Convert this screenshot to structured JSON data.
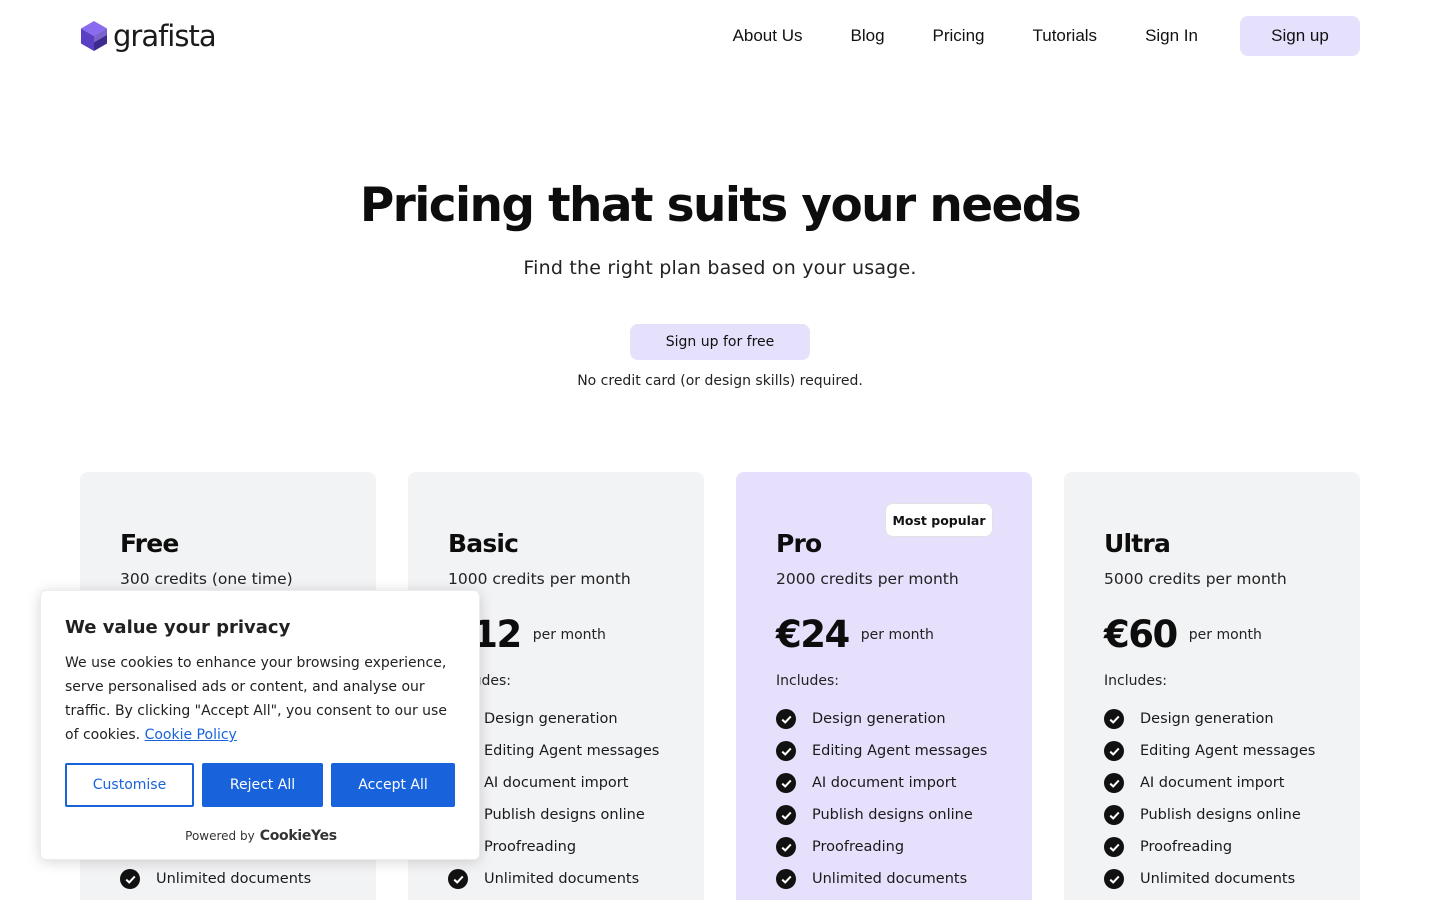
{
  "brand": {
    "name": "grafista",
    "logo_icon": "cube-logo-icon",
    "accent": "#6b4fd8"
  },
  "nav": {
    "links": [
      "About Us",
      "Blog",
      "Pricing",
      "Tutorials",
      "Sign In"
    ],
    "signup_label": "Sign up"
  },
  "hero": {
    "title": "Pricing that suits your needs",
    "subtitle": "Find the right plan based on your usage.",
    "cta_label": "Sign up for free",
    "note": "No credit card (or design skills) required."
  },
  "plans": [
    {
      "name": "Free",
      "credits": "300 credits (one time)",
      "price": "",
      "period": "",
      "includes_label": "",
      "features": [
        "",
        "",
        "",
        "",
        "",
        "Unlimited documents"
      ]
    },
    {
      "name": "Basic",
      "credits": "1000 credits per month",
      "price": "€12",
      "period": "per month",
      "includes_label": "Includes:",
      "features": [
        "Design generation",
        "Editing Agent messages",
        "AI document import",
        "Publish designs online",
        "Proofreading",
        "Unlimited documents"
      ]
    },
    {
      "name": "Pro",
      "credits": "2000 credits per month",
      "price": "€24",
      "period": "per month",
      "includes_label": "Includes:",
      "badge": "Most popular",
      "features": [
        "Design generation",
        "Editing Agent messages",
        "AI document import",
        "Publish designs online",
        "Proofreading",
        "Unlimited documents"
      ]
    },
    {
      "name": "Ultra",
      "credits": "5000 credits per month",
      "price": "€60",
      "period": "per month",
      "includes_label": "Includes:",
      "features": [
        "Design generation",
        "Editing Agent messages",
        "AI document import",
        "Publish designs online",
        "Proofreading",
        "Unlimited documents"
      ]
    }
  ],
  "cookie_banner": {
    "title": "We value your privacy",
    "text": "We use cookies to enhance your browsing experience, serve personalised ads or content, and analyse our traffic. By clicking \"Accept All\", you consent to our use of cookies.",
    "policy_link": "Cookie Policy",
    "customise_label": "Customise",
    "reject_label": "Reject All",
    "accept_label": "Accept All",
    "powered_by": "Powered by",
    "powered_brand": "CookieYes",
    "accent": "#1863dc"
  },
  "colors": {
    "card_bg": "#f2f3f5",
    "card_highlight_bg": "#e6e0fc",
    "button_bg": "#e5e0fb"
  }
}
